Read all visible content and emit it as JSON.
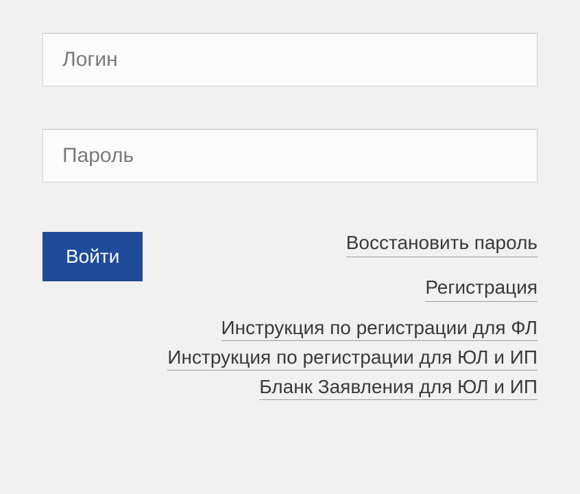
{
  "form": {
    "login": {
      "placeholder": "Логин",
      "value": ""
    },
    "password": {
      "placeholder": "Пароль",
      "value": ""
    },
    "submit_label": "Войти"
  },
  "links": {
    "restore_password": "Восстановить пароль",
    "registration": "Регистрация",
    "instruction_fl": "Инструкция по регистрации для ФЛ",
    "instruction_ul_ip": "Инструкция по регистрации для ЮЛ и ИП",
    "blank_ul_ip": "Бланк Заявления для ЮЛ и ИП"
  },
  "colors": {
    "button_bg": "#1f4b99",
    "button_text": "#ffffff",
    "page_bg": "#f1f1f1",
    "input_bg": "#fcfcfc"
  }
}
